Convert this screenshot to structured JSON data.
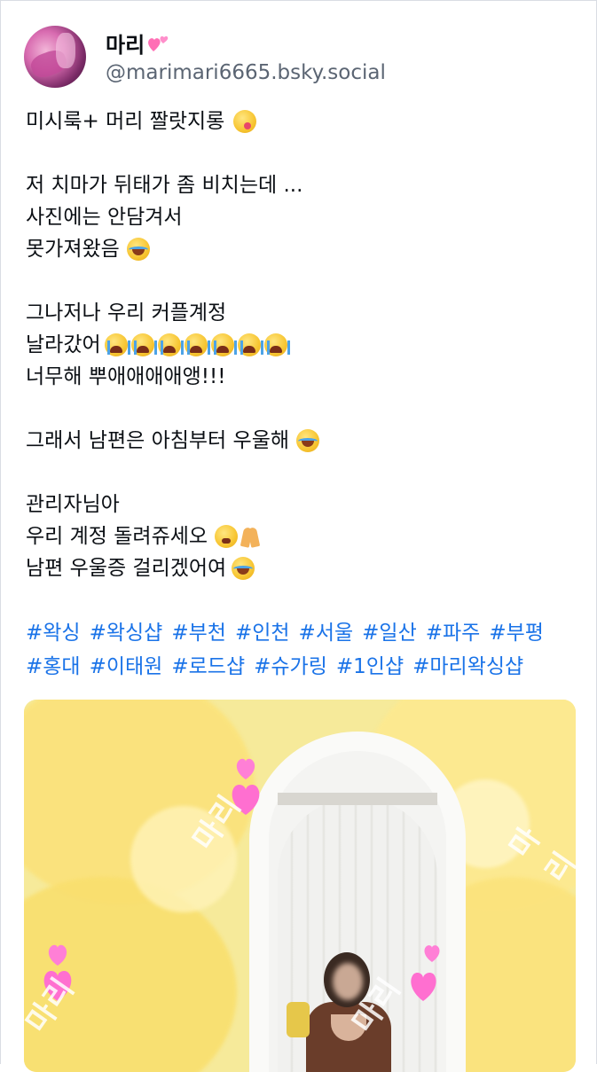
{
  "post": {
    "author_name": "마리",
    "author_handle": "@marimari6665.bsky.social",
    "name_emoji": "two-hearts-emoji",
    "lines": {
      "l1": "미시룩+ 머리 짤랏지롱",
      "l2": "저 치마가 뒤태가 좀 비치는데 ...",
      "l3": "사진에는 안담겨서",
      "l4": "못가져왔음",
      "l5": "그나저나 우리 커플계정",
      "l6": "날라갔어",
      "l7": "너무해 뿌애애애애앵!!!",
      "l8": "그래서 남편은 아침부터 우울해",
      "l9": "관리자님아",
      "l10": "우리 계정 돌려쥬세오",
      "l11": "남편 우울증 걸리겠어여"
    },
    "hashtags_row1": [
      "#왁싱",
      "#왁싱샵",
      "#부천",
      "#인천",
      "#서울",
      "#일산",
      "#파주",
      "#부평"
    ],
    "hashtags_row2": [
      "#홍대",
      "#이태원",
      "#로드샵",
      "#슈가링",
      "#1인샵",
      "#마리왁싱샵"
    ]
  },
  "media": {
    "watermark": "마리",
    "background_color": "#f6ea9a",
    "accent_heart_color": "#ff5fc8"
  },
  "colors": {
    "link": "#1a73e8",
    "text": "#0b0f14",
    "handle": "#5b6573"
  }
}
